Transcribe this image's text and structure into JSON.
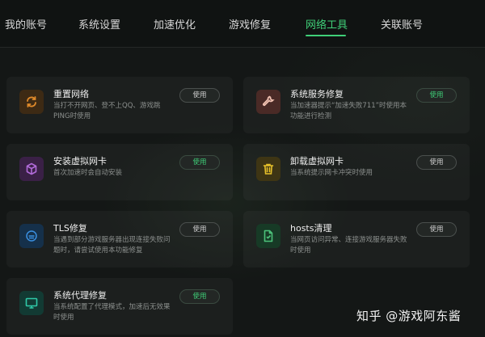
{
  "nav": {
    "tabs": [
      {
        "label": "我的账号"
      },
      {
        "label": "系统设置"
      },
      {
        "label": "加速优化"
      },
      {
        "label": "游戏修复"
      },
      {
        "label": "网络工具"
      },
      {
        "label": "关联账号"
      }
    ],
    "active_tab": "网络工具"
  },
  "tools": [
    {
      "title": "重置网络",
      "desc": "当打不开网页、登不上QQ、游戏跳PING时使用",
      "button": "使用",
      "icon": "refresh-icon",
      "icon_color": "#e08a2a",
      "icon_bg": "#3d2a14"
    },
    {
      "title": "系统服务修复",
      "desc": "当加速器提示“加速失败711”时使用本功能进行检测",
      "button": "使用",
      "icon": "wrench-icon",
      "icon_color": "#f0c0b0",
      "icon_bg": "#4a2a26"
    },
    {
      "title": "安装虚拟网卡",
      "desc": "首次加速时会自动安装",
      "button": "使用",
      "icon": "cube-icon",
      "icon_color": "#b06ad8",
      "icon_bg": "#3a2046"
    },
    {
      "title": "卸载虚拟网卡",
      "desc": "当系统提示网卡冲突时使用",
      "button": "使用",
      "icon": "trash-icon",
      "icon_color": "#e6c02a",
      "icon_bg": "#3e3514"
    },
    {
      "title": "TLS修复",
      "desc": "当遇到部分游戏服务器出现连接失败问题时，请尝试使用本功能修复",
      "button": "使用",
      "icon": "tls-icon",
      "icon_color": "#3a8fe0",
      "icon_bg": "#15304a"
    },
    {
      "title": "hosts清理",
      "desc": "当网页访问异常、连接游戏服务器失败时使用",
      "button": "使用",
      "icon": "document-icon",
      "icon_color": "#4cc27a",
      "icon_bg": "#173a26"
    },
    {
      "title": "系统代理修复",
      "desc": "当系统配置了代理模式，加速后无效果时使用",
      "button": "使用",
      "icon": "monitor-icon",
      "icon_color": "#2fc9a8",
      "icon_bg": "#123a33"
    }
  ],
  "watermark": "知乎 @游戏阿东酱",
  "colors": {
    "accent": "#3fcf78",
    "background": "#141716",
    "card": "#1c1f1e"
  }
}
